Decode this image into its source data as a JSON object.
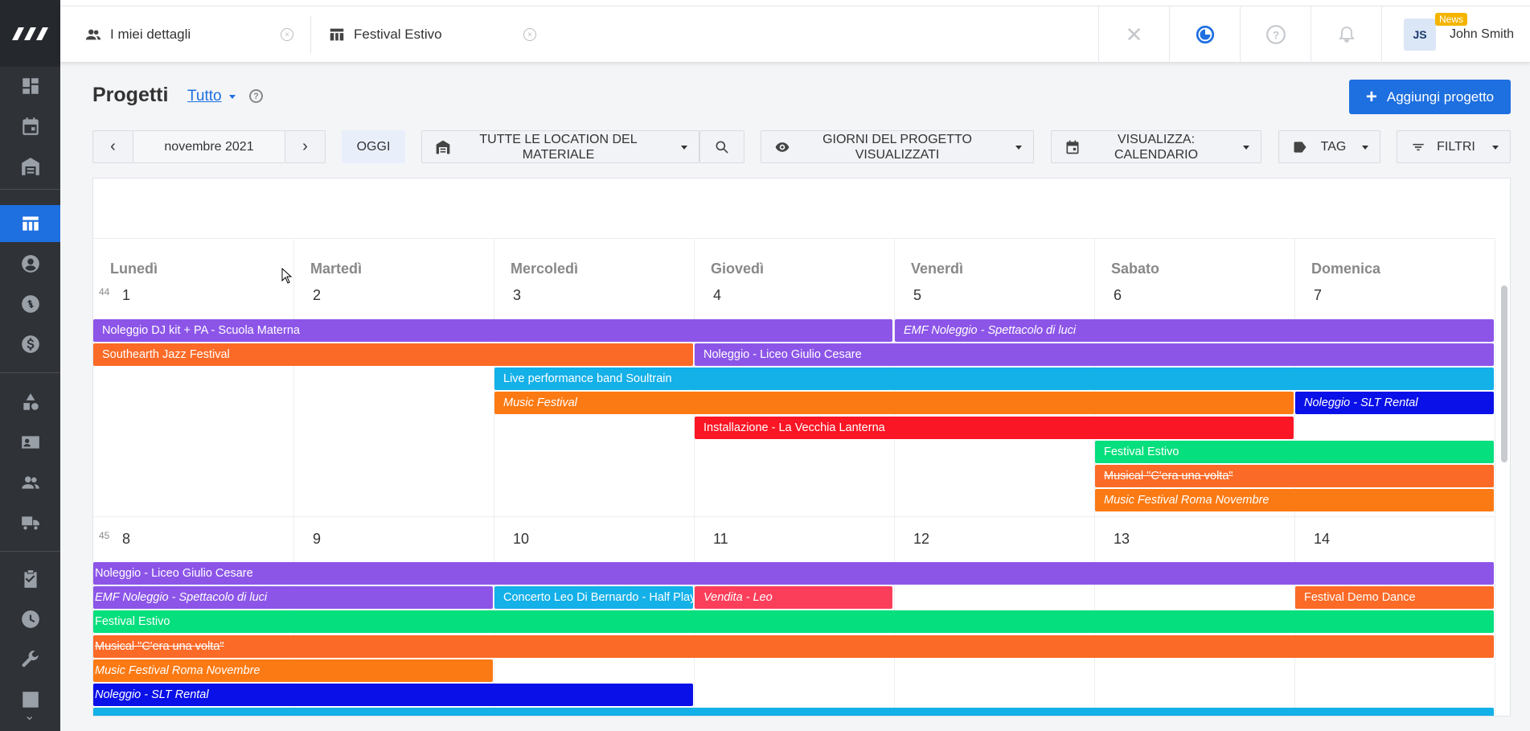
{
  "sidebar": {
    "icons": [
      "dashboard-icon",
      "calendar-icon",
      "warehouse-icon",
      "projects-icon",
      "user-icon",
      "sync-icon",
      "dollar-icon",
      "shapes-icon",
      "contact-card-icon",
      "people-icon",
      "truck-icon",
      "clipboard-icon",
      "clock-icon",
      "wrench-icon",
      "chart-icon"
    ]
  },
  "tabs": [
    {
      "label": "I miei dettagli",
      "icon": "people-icon"
    },
    {
      "label": "Festival Estivo",
      "icon": "table-icon"
    }
  ],
  "user": {
    "initials": "JS",
    "name": "John Smith",
    "badge": "News"
  },
  "header": {
    "title": "Progetti",
    "scope": "Tutto",
    "add_button": "Aggiungi progetto"
  },
  "toolbar": {
    "month": "novembre 2021",
    "today": "OGGI",
    "location": "TUTTE LE LOCATION DEL MATERIALE",
    "days_visible": "GIORNI DEL PROGETTO VISUALIZZATI",
    "view": "VISUALIZZA: CALENDARIO",
    "tag": "TAG",
    "filters": "FILTRI"
  },
  "calendar": {
    "day_names": [
      "Lunedì",
      "Martedì",
      "Mercoledì",
      "Giovedì",
      "Venerdì",
      "Sabato",
      "Domenica"
    ],
    "weeks": [
      {
        "number": "44",
        "days": [
          "1",
          "2",
          "3",
          "4",
          "5",
          "6",
          "7"
        ]
      },
      {
        "number": "45",
        "days": [
          "8",
          "9",
          "10",
          "11",
          "12",
          "13",
          "14"
        ]
      }
    ],
    "events_week1": [
      {
        "label": "Noleggio DJ kit + PA - Scuola Materna",
        "color": "#8c55e8"
      },
      {
        "label": "EMF Noleggio - Spettacolo di luci",
        "color": "#8c55e8"
      },
      {
        "label": "Southearth Jazz Festival",
        "color": "#fb6a26"
      },
      {
        "label": "Noleggio - Liceo Giulio Cesare",
        "color": "#8c55e8"
      },
      {
        "label": "Live performance band Soultrain",
        "color": "#14b0e8"
      },
      {
        "label": "Music Festival",
        "color": "#fc7a13"
      },
      {
        "label": "Noleggio - SLT Rental",
        "color": "#0a10e8"
      },
      {
        "label": "Installazione - La Vecchia Lanterna",
        "color": "#fa1625"
      },
      {
        "label": "Festival Estivo",
        "color": "#06df7d"
      },
      {
        "label": "Musical \"C'era una volta\"",
        "color": "#fb6a26"
      },
      {
        "label": "Music Festival Roma Novembre",
        "color": "#fc7a13"
      }
    ],
    "events_week2": [
      {
        "label": "Noleggio - Liceo Giulio Cesare",
        "color": "#8c55e8"
      },
      {
        "label": "EMF Noleggio - Spettacolo di luci",
        "color": "#8c55e8"
      },
      {
        "label": "Concerto Leo Di Bernardo - Half Playl",
        "color": "#14b0e8"
      },
      {
        "label": "Vendita - Leo",
        "color": "#fb3f5b"
      },
      {
        "label": "Festival Demo Dance",
        "color": "#fb6a26"
      },
      {
        "label": "Festival Estivo",
        "color": "#06df7d"
      },
      {
        "label": "Musical \"C'era una volta\"",
        "color": "#fb6a26"
      },
      {
        "label": "Music Festival Roma Novembre",
        "color": "#fc7a13"
      },
      {
        "label": "Noleggio - SLT Rental",
        "color": "#0a10e8"
      }
    ]
  }
}
